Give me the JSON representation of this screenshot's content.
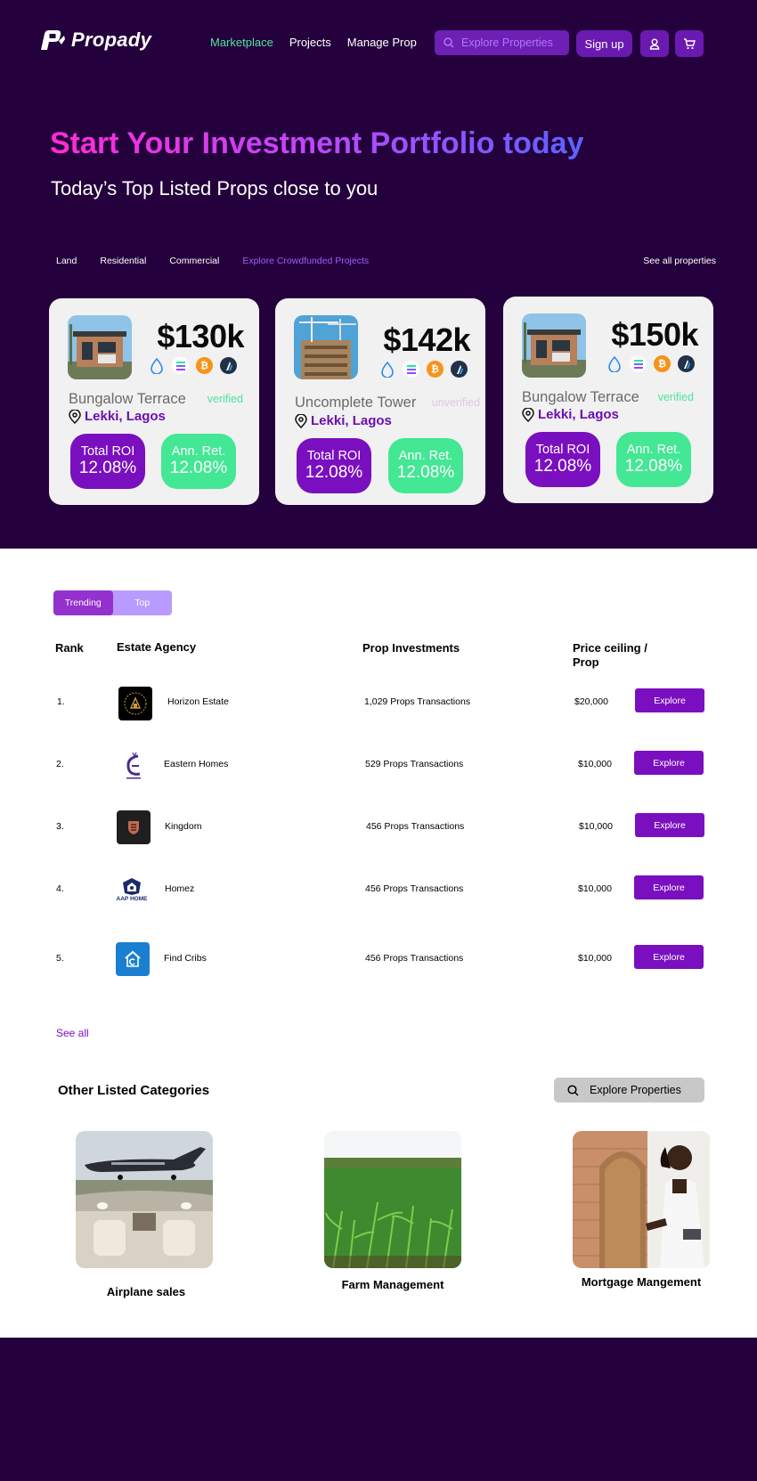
{
  "brand": {
    "name": "Propady"
  },
  "nav": {
    "items": [
      "Marketplace",
      "Projects",
      "Manage Prop"
    ],
    "active": "Marketplace"
  },
  "header": {
    "search_placeholder": "Explore Properties",
    "signup_label": "Sign up",
    "icons": [
      "user-icon",
      "cart-icon"
    ]
  },
  "hero": {
    "title": "Start Your Investment Portfolio today",
    "subtitle": "Today’s Top Listed Props close to you",
    "gradient_colors": [
      "#ff2bd4",
      "#b54bff",
      "#5b62ff"
    ]
  },
  "filters": {
    "items": [
      "Land",
      "Residential",
      "Commercial",
      "Explore Crowdfunded Projects"
    ],
    "active": "Explore Crowdfunded Projects",
    "see_all": "See all properties"
  },
  "cards": [
    {
      "price": "$130k",
      "name": "Bungalow Terrace",
      "status": "verified",
      "location": "Lekki, Lagos",
      "roi_label": "Total ROI",
      "roi_value": "12.08%",
      "ann_label": "Ann. Ret.",
      "ann_value": "12.08%",
      "image": "bungalow-image",
      "coins": [
        "drop-icon",
        "solana-icon",
        "bitcoin-icon",
        "arbitrum-icon"
      ]
    },
    {
      "price": "$142k",
      "name": "Uncomplete Tower",
      "status": "unverified",
      "location": "Lekki, Lagos",
      "roi_label": "Total ROI",
      "roi_value": "12.08%",
      "ann_label": "Ann. Ret.",
      "ann_value": "12.08%",
      "image": "tower-construction-image",
      "coins": [
        "drop-icon",
        "solana-icon",
        "bitcoin-icon",
        "arbitrum-icon"
      ]
    },
    {
      "price": "$150k",
      "name": "Bungalow Terrace",
      "status": "verified",
      "location": "Lekki, Lagos",
      "roi_label": "Total ROI",
      "roi_value": "12.08%",
      "ann_label": "Ann. Ret.",
      "ann_value": "12.08%",
      "image": "bungalow-image",
      "coins": [
        "drop-icon",
        "solana-icon",
        "bitcoin-icon",
        "arbitrum-icon"
      ]
    }
  ],
  "ranking": {
    "tabs": [
      "Trending",
      "Top"
    ],
    "active_tab": "Trending",
    "headers": {
      "rank": "Rank",
      "agency": "Estate Agency",
      "investments": "Prop Investments",
      "price": "Price ceiling / Prop"
    },
    "rows": [
      {
        "rank": "1.",
        "agency": "Horizon Estate",
        "investments": "1,029 Props Transactions",
        "price": "$20,000",
        "action": "Explore",
        "logo": "horizon-logo"
      },
      {
        "rank": "2.",
        "agency": "Eastern Homes",
        "investments": "529 Props Transactions",
        "price": "$10,000",
        "action": "Explore",
        "logo": "eastern-homes-logo"
      },
      {
        "rank": "3.",
        "agency": "Kingdom",
        "investments": "456 Props Transactions",
        "price": "$10,000",
        "action": "Explore",
        "logo": "kingdom-logo"
      },
      {
        "rank": "4.",
        "agency": "Homez",
        "investments": "456 Props Transactions",
        "price": "$10,000",
        "action": "Explore",
        "logo": "homez-logo",
        "logo_text": "AAP HOME"
      },
      {
        "rank": "5.",
        "agency": "Find Cribs",
        "investments": "456 Props Transactions",
        "price": "$10,000",
        "action": "Explore",
        "logo": "find-cribs-logo"
      }
    ],
    "see_all": "See all"
  },
  "categories": {
    "title": "Other Listed Categories",
    "explore_label": "Explore Properties",
    "items": [
      {
        "label": "Airplane sales",
        "image": "private-jet-image"
      },
      {
        "label": "Farm Management",
        "image": "corn-farm-image"
      },
      {
        "label": "Mortgage Mangement",
        "image": "woman-at-door-image"
      }
    ]
  },
  "colors": {
    "dark_purple": "#24003c",
    "accent_purple": "#7a0fbf",
    "mint": "#4ee3a0",
    "card_bg": "#f1f1f1"
  }
}
